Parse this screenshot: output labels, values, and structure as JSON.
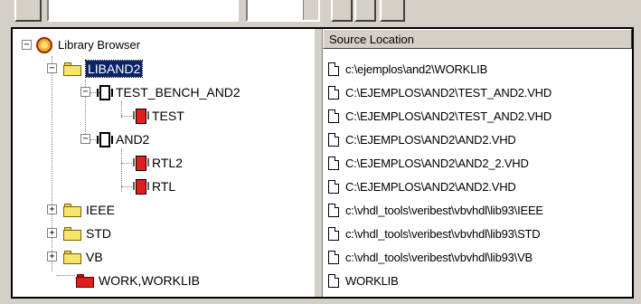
{
  "browser": {
    "root_label": "Library Browser",
    "column_header": "Source Location",
    "tree": [
      {
        "label": "LIBAND2",
        "expander": "−"
      },
      {
        "label": "TEST_BENCH_AND2",
        "expander": "−"
      },
      {
        "label": "TEST"
      },
      {
        "label": "AND2",
        "expander": "−"
      },
      {
        "label": "RTL2"
      },
      {
        "label": "RTL"
      },
      {
        "label": "IEEE",
        "expander": "+"
      },
      {
        "label": "STD",
        "expander": "+"
      },
      {
        "label": "VB",
        "expander": "+"
      },
      {
        "label": "WORK,WORKLIB"
      }
    ],
    "root_expander": "−",
    "sources": [
      "c:\\ejemplos\\and2\\WORKLIB",
      "C:\\EJEMPLOS\\AND2\\TEST_AND2.VHD",
      "C:\\EJEMPLOS\\AND2\\TEST_AND2.VHD",
      "C:\\EJEMPLOS\\AND2\\AND2.VHD",
      "C:\\EJEMPLOS\\AND2\\AND2_2.VHD",
      "C:\\EJEMPLOS\\AND2\\AND2.VHD",
      "c:\\vhdl_tools\\veribest\\vbvhdl\\lib93\\IEEE",
      "c:\\vhdl_tools\\veribest\\vbvhdl\\lib93\\STD",
      "c:\\vhdl_tools\\veribest\\vbvhdl\\lib93\\VB",
      "WORKLIB"
    ]
  },
  "colors": {
    "selection": "#0a246a",
    "folder": "#f5e56b",
    "work_folder": "#e02020",
    "architecture": "#e02020"
  }
}
